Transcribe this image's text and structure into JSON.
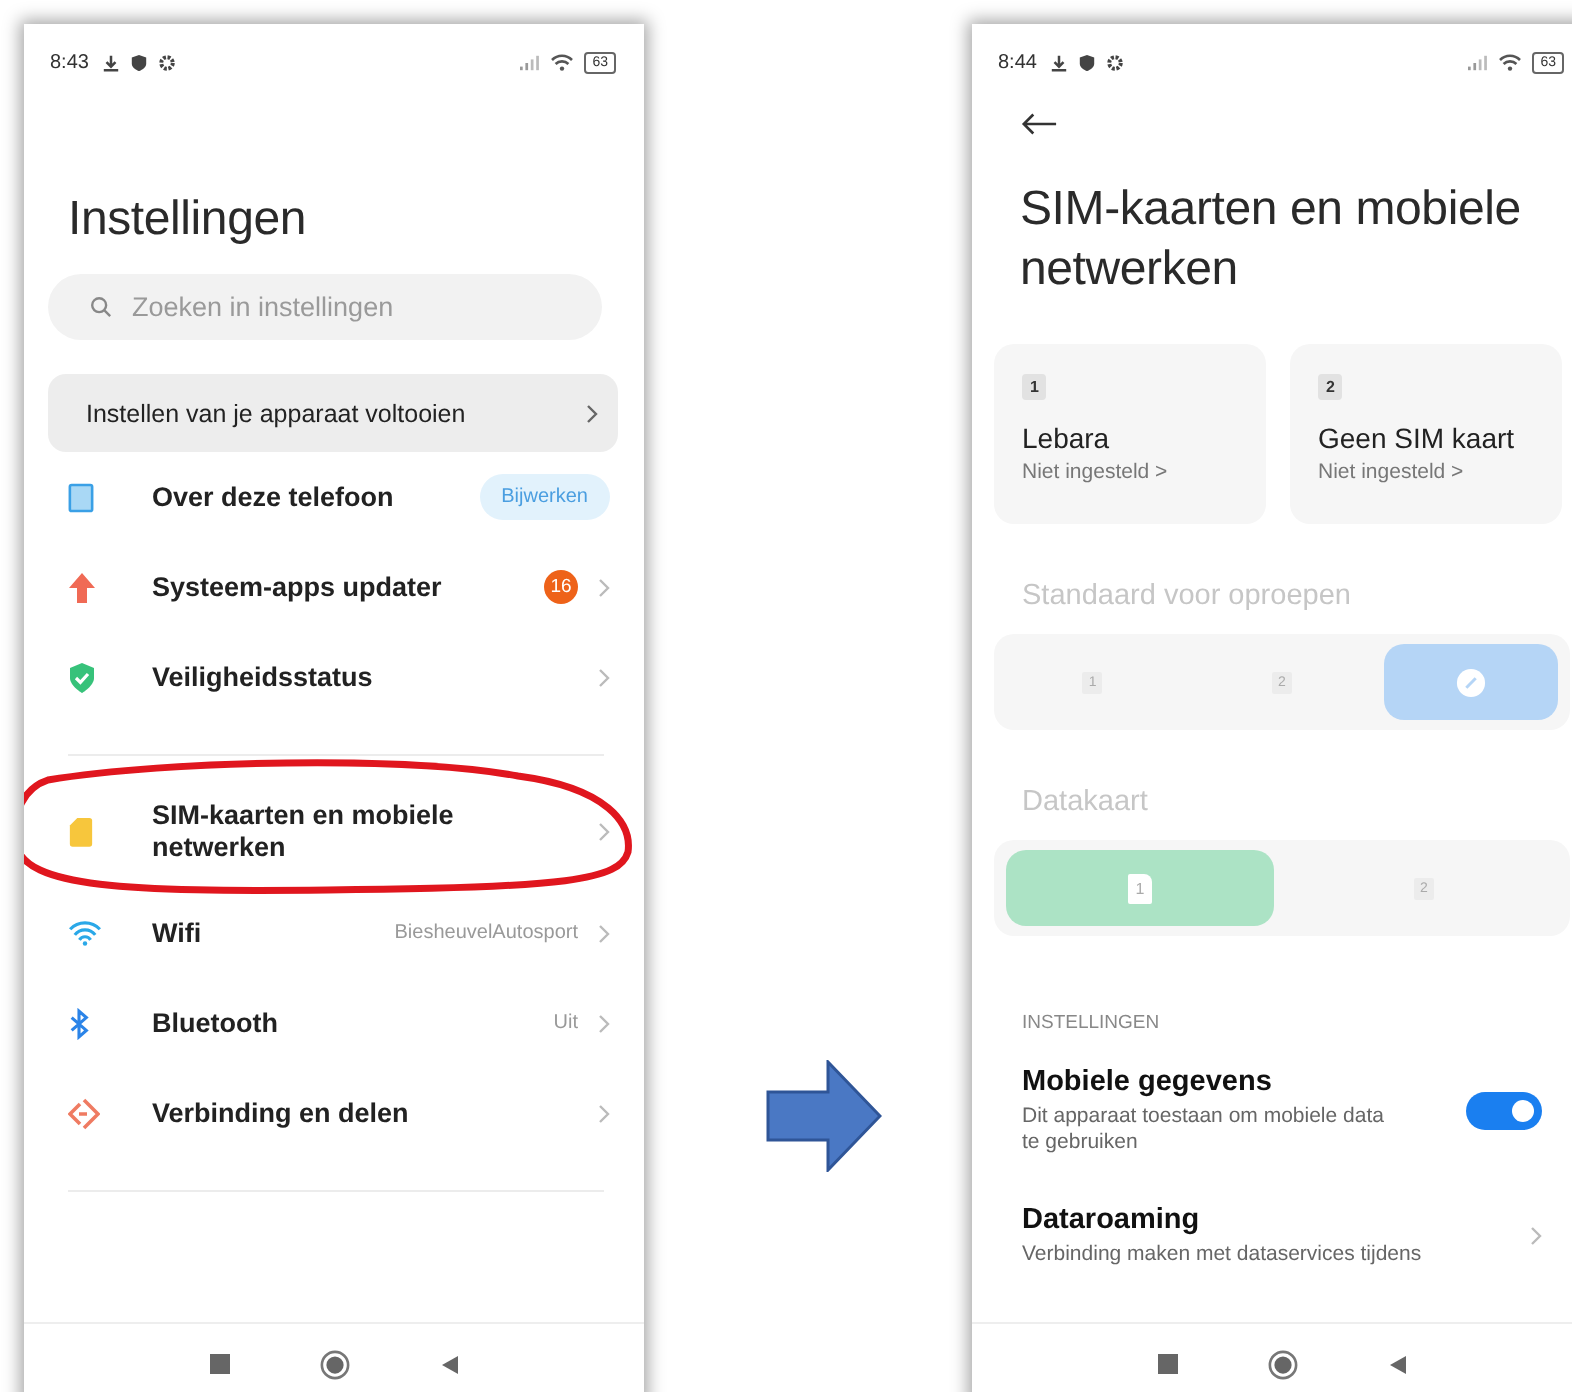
{
  "left_screen": {
    "status_bar": {
      "time": "8:43",
      "battery": "63"
    },
    "title": "Instellingen",
    "search": {
      "placeholder": "Zoeken in instellingen"
    },
    "setup_card": {
      "label": "Instellen van je apparaat voltooien"
    },
    "groups": [
      {
        "items": [
          {
            "label": "Over deze telefoon",
            "action": "Bijwerken",
            "circled": false
          },
          {
            "label": "Systeem-apps updater",
            "count": "16",
            "circled": false
          },
          {
            "label": "Veiligheidsstatus",
            "circled": false
          }
        ]
      },
      {
        "items": [
          {
            "label": "SIM-kaarten en mobiele netwerken",
            "circled": true
          },
          {
            "label": "Wifi",
            "value": "BiesheuvelAutosport",
            "circled": false
          },
          {
            "label": "Bluetooth",
            "value": "Uit",
            "circled": false
          },
          {
            "label": "Verbinding en delen",
            "circled": false
          }
        ]
      }
    ]
  },
  "right_screen": {
    "status_bar": {
      "time": "8:44",
      "battery": "63"
    },
    "title": "SIM-kaarten en mobiele netwerken",
    "sim_cards": [
      {
        "slot": "1",
        "name": "Lebara",
        "status": "Niet ingesteld >"
      },
      {
        "slot": "2",
        "name": "Geen SIM kaart",
        "status": "Niet ingesteld >"
      }
    ],
    "selectors": [
      {
        "label": "Standaard voor oproepen",
        "disabled": true,
        "color": "#b5d5f6",
        "options": [
          {
            "kind": "slot",
            "slot": "1",
            "selected": false
          },
          {
            "kind": "slot",
            "slot": "2",
            "selected": false
          },
          {
            "kind": "ask",
            "selected": true
          }
        ]
      },
      {
        "label": "Datakaart",
        "disabled": true,
        "color": "#ace3c5",
        "options": [
          {
            "kind": "slot",
            "slot": "1",
            "selected": true
          },
          {
            "kind": "slot",
            "slot": "2",
            "selected": false
          }
        ]
      }
    ],
    "section_header": "INSTELLINGEN",
    "settings": [
      {
        "kind": "toggle",
        "title": "Mobiele gegevens",
        "description": "Dit apparaat toestaan om mobiele data te gebruiken",
        "on": true
      },
      {
        "kind": "link",
        "title": "Dataroaming",
        "description": "Verbinding maken met dataservices tijdens"
      }
    ]
  }
}
